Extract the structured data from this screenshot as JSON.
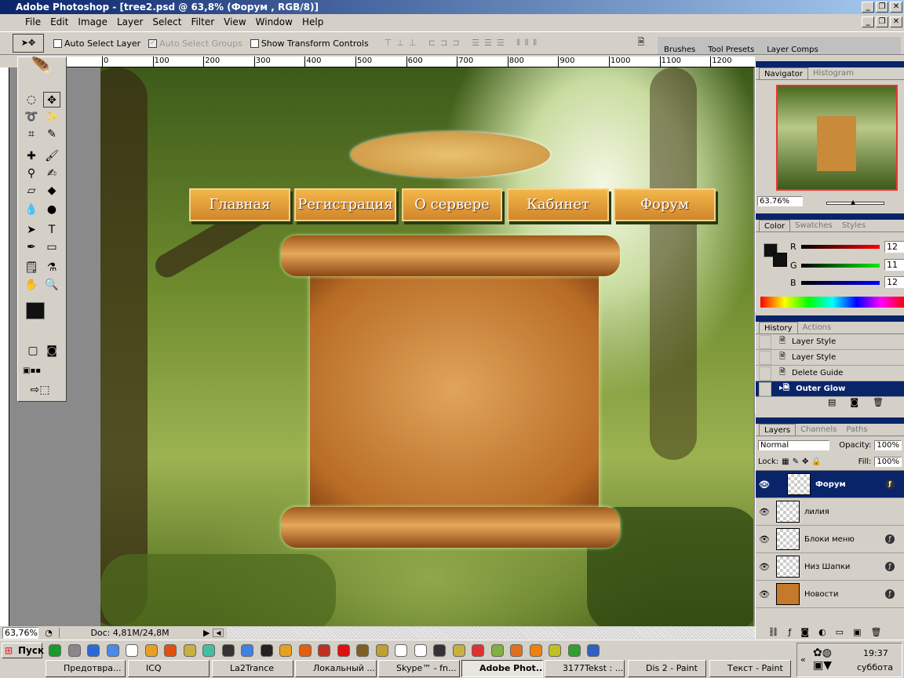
{
  "window": {
    "title": "Adobe Photoshop - [tree2.psd @ 63,8% (Форум , RGB/8)]"
  },
  "menu": [
    "File",
    "Edit",
    "Image",
    "Layer",
    "Select",
    "Filter",
    "View",
    "Window",
    "Help"
  ],
  "options": {
    "auto_select_layer": "Auto Select Layer",
    "auto_select_groups": "Auto Select Groups",
    "show_transform": "Show Transform Controls",
    "well_tabs": [
      "Brushes",
      "Tool Presets",
      "Layer Comps"
    ]
  },
  "ruler": [
    "0",
    "100",
    "200",
    "300",
    "400",
    "500",
    "600",
    "700",
    "800",
    "900",
    "1000",
    "1100",
    "1200"
  ],
  "canvas": {
    "menu_buttons": [
      "Главная",
      "Регистрация",
      "О сервере",
      "Кабинет",
      "Форум"
    ]
  },
  "status": {
    "zoom": "63,76%",
    "doc": "Doc: 4,81M/24,8M"
  },
  "navigator": {
    "tabs": [
      "Navigator",
      "Histogram"
    ],
    "zoom": "63.76%"
  },
  "color": {
    "tabs": [
      "Color",
      "Swatches",
      "Styles"
    ],
    "r_label": "R",
    "g_label": "G",
    "b_label": "B",
    "r": "12",
    "g": "11",
    "b": "12"
  },
  "history": {
    "tabs": [
      "History",
      "Actions"
    ],
    "items": [
      "Layer Style",
      "Layer Style",
      "Delete Guide",
      "Outer Glow"
    ]
  },
  "layers": {
    "tabs": [
      "Layers",
      "Channels",
      "Paths"
    ],
    "blend": "Normal",
    "opacity_label": "Opacity:",
    "opacity": "100%",
    "lock_label": "Lock:",
    "fill_label": "Fill:",
    "fill": "100%",
    "items": [
      "Форум",
      "лилия",
      "Блоки меню",
      "Низ Шапки",
      "Новости"
    ]
  },
  "taskbar": {
    "start": "Пуск",
    "buttons": [
      "Предотвра...",
      "ICQ",
      "La2Trance",
      "Локальный ...",
      "Skype™ - fn...",
      "Adobe Phot...",
      "3177Tekst : ...",
      "Dis 2 - Paint",
      "Текст - Paint"
    ],
    "time": "19:37",
    "day": "суббота"
  }
}
